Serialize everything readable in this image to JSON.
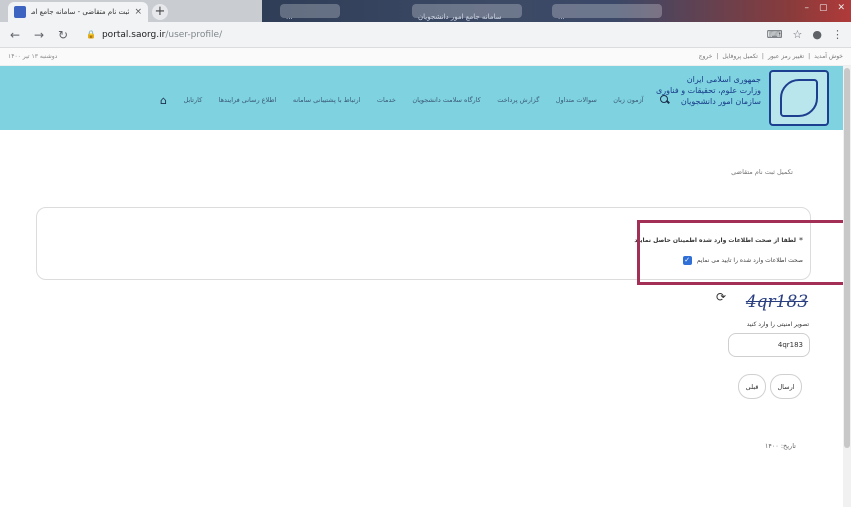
{
  "browser": {
    "active_tab_title": "ثبت نام متقاضی - سامانه جامع امور دانشجویان",
    "other_tabs": [
      "...",
      "سامانه جامع امور دانشجویان",
      "..."
    ],
    "url_host": "portal.saorg.ir",
    "url_path": "/user-profile/",
    "new_tab": "+",
    "close": "×"
  },
  "topstrip": {
    "left": "دوشنبه ۱۳ تیر ۱۴۰۰",
    "links": [
      "خوش آمدید",
      "تغییر رمز عبور",
      "تکمیل پروفایل",
      "خروج"
    ]
  },
  "org": {
    "line1": "جمهوری اسلامی ایران",
    "line2": "وزارت علوم، تحقیقات و فناوری",
    "line3": "سازمان امور دانشجویان"
  },
  "nav": {
    "items": [
      "کارتابل",
      "اطلاع رسانی فرایندها",
      "ارتباط با پشتیبانی سامانه",
      "خدمات",
      "کارگاه سلامت دانشجویان",
      "گزارش پرداخت",
      "سوالات متداول",
      "آزمون زبان"
    ]
  },
  "content": {
    "breadcrumb": "تکمیل ثبت نام متقاضی",
    "required_star": "*",
    "required_text": "لطفا از صحت اطلاعات وارد شده اطمینان حاصل نمایید",
    "confirm_label": "صحت اطلاعات وارد شده را تایید می نمایم",
    "captcha_text": "4qr183",
    "captcha_label": "تصویر امنیتی را وارد کنید",
    "captcha_value": "4qr183",
    "send_button": "ارسال",
    "prev_button": "قبلی",
    "history": "تاریخ: ۱۴۰۰"
  }
}
